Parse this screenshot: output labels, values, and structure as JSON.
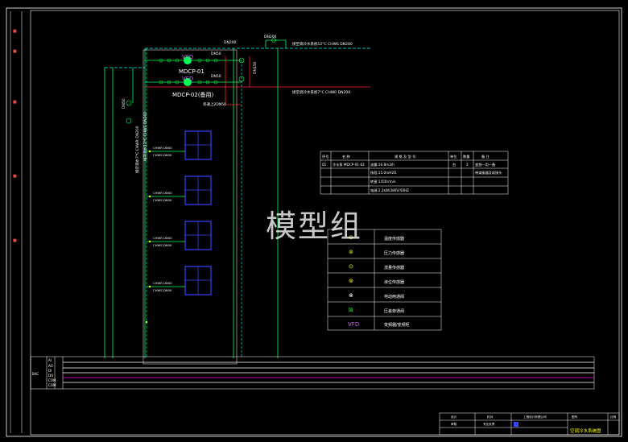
{
  "watermark": "模型组",
  "pipes": {
    "main_top_size": "DN200",
    "main_top_bypass_size": "DN200",
    "supply_line_label": "接空调冷水系统12°C CHWS DN200",
    "return_line_label": "接空调冷水系统7°C CHWR DN200",
    "dn150_label": "DN150",
    "dn50_a": "DN50",
    "dn50_b": "DN50",
    "dn50_c": "DN50",
    "bypass_label": "旁通上2DN50",
    "dn50_left": "DN50",
    "vert_left_label": "接空调水7°C CHWR DN200",
    "vert_right_label": "接空调水12°C CHWS DN200"
  },
  "pumps": [
    {
      "tag": "VFD",
      "name": "MDCP-01"
    },
    {
      "tag": "VFD",
      "name": "MDCP-02(备用)"
    }
  ],
  "units": [
    {
      "label_a": "CHWR DN50",
      "label_b": "CHWS DN50"
    },
    {
      "label_a": "CHWR DN50",
      "label_b": "CHWS DN50"
    },
    {
      "label_a": "CHWR DN50",
      "label_b": "CHWS DN50"
    },
    {
      "label_a": "CHWR DN50",
      "label_b": "CHWS DN50"
    }
  ],
  "equipment_table": {
    "headers": [
      "序号",
      "名 称",
      "规 格 及 型 号",
      "单位",
      "数量",
      "备 注"
    ],
    "rows": [
      [
        "01",
        "冷水泵 MDCP-01-02",
        "流量:16.8m3/h",
        "台",
        "2",
        "变频一用一备"
      ],
      [
        "",
        "",
        "扬程:15.0mH2O",
        "",
        "",
        "带减振器及软接头"
      ],
      [
        "",
        "",
        "转速:1450r/min",
        "",
        "",
        ""
      ],
      [
        "",
        "",
        "电源:2.2kW/380V/50HZ",
        "",
        "",
        ""
      ]
    ]
  },
  "legend": [
    {
      "symbol": "⊝",
      "color": "#ffff00",
      "text": "温度传感器"
    },
    {
      "symbol": "⊚",
      "color": "#ffff00",
      "text": "压力传感器"
    },
    {
      "symbol": "⊙",
      "color": "#ffff00",
      "text": "流量传感器"
    },
    {
      "symbol": "⊚",
      "color": "#ffff00",
      "text": "液位传感器"
    },
    {
      "symbol": "⊗",
      "color": "#ffffff",
      "text": "电动两通阀"
    },
    {
      "symbol": "⊠",
      "color": "#00ff00",
      "text": "压差旁通阀"
    },
    {
      "symbol": "VFD",
      "color": "#cc66ff",
      "text": "变频器/变频柜"
    }
  ],
  "bus_rows": {
    "left_label": "BAC",
    "row_labels": [
      "AI",
      "AO",
      "DI",
      "DO",
      "COM",
      "COM"
    ]
  },
  "title_block": {
    "drawing_title": "空调冷水系统图",
    "company": "工程设计有限公司",
    "cells": [
      "设计",
      "校对",
      "审核",
      "专业负责",
      "图号",
      "比例"
    ]
  },
  "colors": {
    "pipe_green": "#00ff55",
    "pipe_cyan": "#00ffff",
    "pipe_red": "#ff2222",
    "unit_blue": "#3344ff",
    "text_white": "#ffffff",
    "yellow": "#ffff00",
    "magenta": "#ff00ff"
  }
}
